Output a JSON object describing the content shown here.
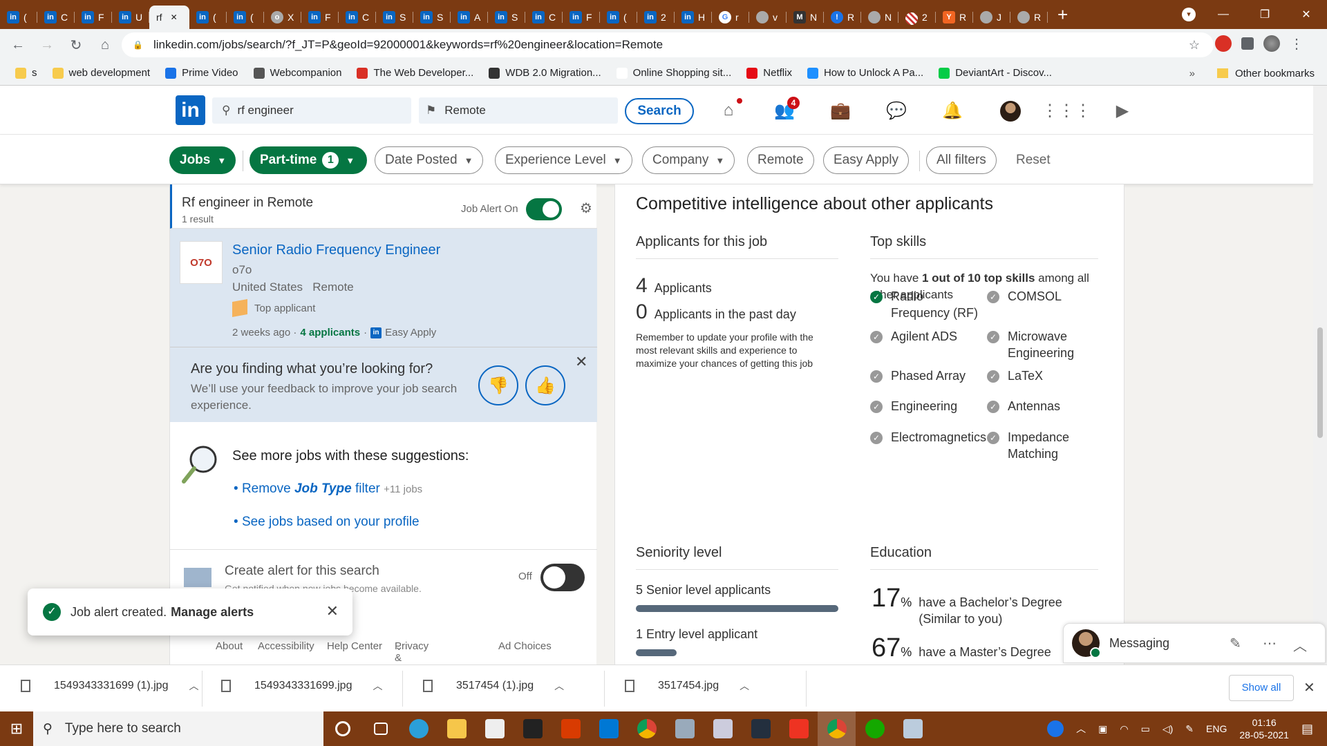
{
  "browser": {
    "tabs": [
      {
        "label": "(",
        "fav": "in"
      },
      {
        "label": "C",
        "fav": "in"
      },
      {
        "label": "F",
        "fav": "in"
      },
      {
        "label": "U",
        "fav": "in"
      },
      {
        "label": "rf",
        "fav": "",
        "active": true
      },
      {
        "label": "(",
        "fav": "in"
      },
      {
        "label": "(",
        "fav": "in"
      },
      {
        "label": "X",
        "fav": "o"
      },
      {
        "label": "F",
        "fav": "in"
      },
      {
        "label": "C",
        "fav": "in"
      },
      {
        "label": "S",
        "fav": "in"
      },
      {
        "label": "S",
        "fav": "in"
      },
      {
        "label": "A",
        "fav": "in"
      },
      {
        "label": "S",
        "fav": "in"
      },
      {
        "label": "C",
        "fav": "in"
      },
      {
        "label": "F",
        "fav": "in"
      },
      {
        "label": "(",
        "fav": "in"
      },
      {
        "label": "2",
        "fav": "in"
      },
      {
        "label": "H",
        "fav": "in"
      },
      {
        "label": "r",
        "fav": "G"
      },
      {
        "label": "v",
        "fav": ""
      },
      {
        "label": "N",
        "fav": "M"
      },
      {
        "label": "R",
        "fav": "!"
      },
      {
        "label": "N",
        "fav": ""
      },
      {
        "label": "2",
        "fav": ""
      },
      {
        "label": "R",
        "fav": "Y"
      },
      {
        "label": "J",
        "fav": ""
      },
      {
        "label": "R",
        "fav": ""
      }
    ],
    "new_tab_label": "+",
    "url": "linkedin.com/jobs/search/?f_JT=P&geoId=92000001&keywords=rf%20engineer&location=Remote",
    "bookmarks": [
      "s",
      "web development",
      "Prime Video",
      "Webcompanion",
      "The Web Developer...",
      "WDB 2.0 Migration...",
      "Online Shopping sit...",
      "Netflix",
      "How to Unlock A Pa...",
      "DeviantArt - Discov..."
    ],
    "bookmarks_more": "»",
    "other_bookmarks": "Other bookmarks"
  },
  "linkedin": {
    "logo": "in",
    "search_value": "rf engineer",
    "location_value": "Remote",
    "search_button": "Search",
    "nav": {
      "home_badge": "",
      "network_badge": "4"
    }
  },
  "filters": {
    "jobs": "Jobs",
    "part_time": "Part-time",
    "part_time_count": "1",
    "date_posted": "Date Posted",
    "experience": "Experience Level",
    "company": "Company",
    "remote": "Remote",
    "easy_apply": "Easy Apply",
    "all_filters": "All filters",
    "reset": "Reset"
  },
  "results": {
    "title": "Rf engineer in Remote",
    "count": "1 result",
    "alert_label": "Job Alert On"
  },
  "job": {
    "logo_text": "O7O",
    "title": "Senior Radio Frequency Engineer",
    "company": "o7o",
    "country": "United States",
    "workplace": "Remote",
    "top_applicant": "Top applicant",
    "posted": "2 weeks ago ·",
    "applicants": "4 applicants",
    "dot": "·",
    "easy_apply": "Easy Apply"
  },
  "feedback": {
    "title": "Are you finding what you’re looking for?",
    "sub": "We’ll use your feedback to improve your job search experience."
  },
  "suggestions": {
    "title": "See more jobs with these suggestions:",
    "link1_pre": "Remove ",
    "link1_em": "Job Type",
    "link1_post": " filter",
    "link1_count": "+11 jobs",
    "link2": "See jobs based on your profile"
  },
  "create_alert": {
    "title": "Create alert for this search",
    "sub": "Get notified when new jobs become available.",
    "off": "Off"
  },
  "footer": [
    "About",
    "Accessibility",
    "Help Center",
    "Privacy & Terms",
    "Ad Choices"
  ],
  "footer_caret": "⌄",
  "insights": {
    "heading": "Competitive intelligence about other applicants",
    "applicants_heading": "Applicants for this job",
    "applicants_num": "4",
    "applicants_lbl": "Applicants",
    "past_day_num": "0",
    "past_day_lbl": "Applicants in the past day",
    "reminder": "Remember to update your profile with the most relevant skills and experience to maximize your chances of getting this job",
    "skills_heading": "Top skills",
    "skills_intro_pre": "You have ",
    "skills_intro_bold": "1 out of 10 top skills",
    "skills_intro_post": " among all other applicants",
    "skills": [
      {
        "name": "Radio Frequency (RF)",
        "have": true
      },
      {
        "name": "COMSOL",
        "have": false
      },
      {
        "name": "Agilent ADS",
        "have": false
      },
      {
        "name": "Microwave Engineering",
        "have": false
      },
      {
        "name": "Phased Array",
        "have": false
      },
      {
        "name": "LaTeX",
        "have": false
      },
      {
        "name": "Engineering",
        "have": false
      },
      {
        "name": "Antennas",
        "have": false
      },
      {
        "name": "Electromagnetics",
        "have": false
      },
      {
        "name": "Impedance Matching",
        "have": false
      }
    ],
    "seniority_heading": "Seniority level",
    "seniority": [
      {
        "label": "5 Senior level applicants",
        "fraction": 1.0
      },
      {
        "label": "1 Entry level applicant",
        "fraction": 0.2
      }
    ],
    "education_heading": "Education",
    "education": [
      {
        "pct": "17",
        "label": "have a Bachelor’s Degree (Similar to you)"
      },
      {
        "pct": "67",
        "label": "have a Master’s Degree"
      }
    ],
    "pct_sign": "%"
  },
  "toast": {
    "msg": "Job alert created.",
    "link": "Manage alerts"
  },
  "messaging": {
    "label": "Messaging"
  },
  "downloads": {
    "items": [
      "1549343331699 (1).jpg",
      "1549343331699.jpg",
      "3517454 (1).jpg",
      "3517454.jpg"
    ],
    "show_all": "Show all"
  },
  "taskbar": {
    "search_placeholder": "Type here to search",
    "lang": "ENG",
    "time": "01:16",
    "date": "28-05-2021"
  },
  "colors": {
    "linkedin_blue": "#0a66c2",
    "linkedin_green": "#057642",
    "chrome_frame": "#7b3a12"
  }
}
